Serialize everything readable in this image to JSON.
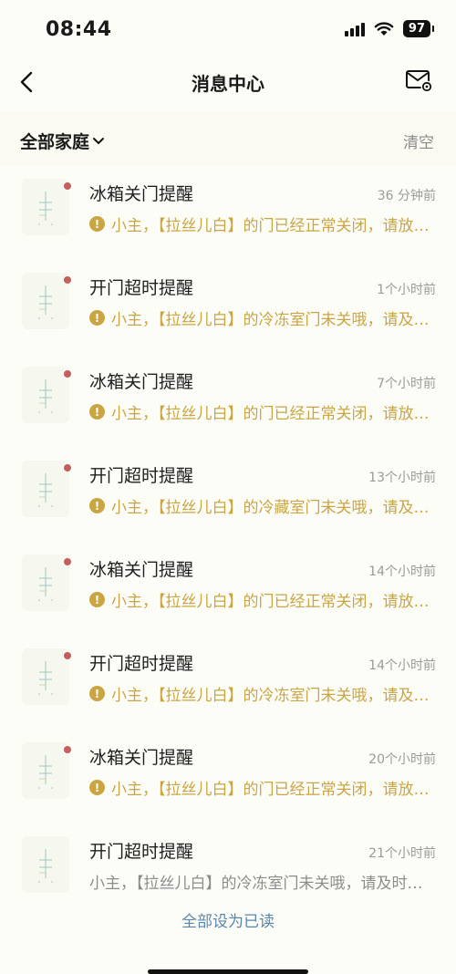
{
  "status_bar": {
    "time": "08:44",
    "battery": "97",
    "icons": [
      "signal-icon",
      "wifi-icon",
      "battery-icon"
    ]
  },
  "nav": {
    "title": "消息中心",
    "back_icon": "chevron-left-icon",
    "settings_icon": "mail-settings-icon"
  },
  "filter": {
    "family_label": "全部家庭",
    "clear_label": "清空"
  },
  "colors": {
    "unread_dot": "#c26060",
    "warning_text": "#c9a543",
    "read_text": "#8c8c8c",
    "link": "#5a86ad"
  },
  "messages": [
    {
      "title": "冰箱关门提醒",
      "time": "36 分钟前",
      "body": "小主，【拉丝儿白】的门已经正常关闭，请放心使用",
      "unread": true
    },
    {
      "title": "开门超时提醒",
      "time": "1个小时前",
      "body": "小主，【拉丝儿白】的冷冻室门未关哦，请及时关闭",
      "unread": true
    },
    {
      "title": "冰箱关门提醒",
      "time": "7个小时前",
      "body": "小主，【拉丝儿白】的门已经正常关闭，请放心使用",
      "unread": true
    },
    {
      "title": "开门超时提醒",
      "time": "13个小时前",
      "body": "小主，【拉丝儿白】的冷藏室门未关哦，请及时关闭",
      "unread": true
    },
    {
      "title": "冰箱关门提醒",
      "time": "14个小时前",
      "body": "小主，【拉丝儿白】的门已经正常关闭，请放心使用",
      "unread": true
    },
    {
      "title": "开门超时提醒",
      "time": "14个小时前",
      "body": "小主，【拉丝儿白】的冷冻室门未关哦，请及时关闭",
      "unread": true
    },
    {
      "title": "冰箱关门提醒",
      "time": "20个小时前",
      "body": "小主，【拉丝儿白】的门已经正常关闭，请放心使用",
      "unread": true
    },
    {
      "title": "开门超时提醒",
      "time": "21个小时前",
      "body": "小主，【拉丝儿白】的冷冻室门未关哦，请及时关闭",
      "unread": false
    }
  ],
  "footer": {
    "mark_all_read": "全部设为已读"
  }
}
